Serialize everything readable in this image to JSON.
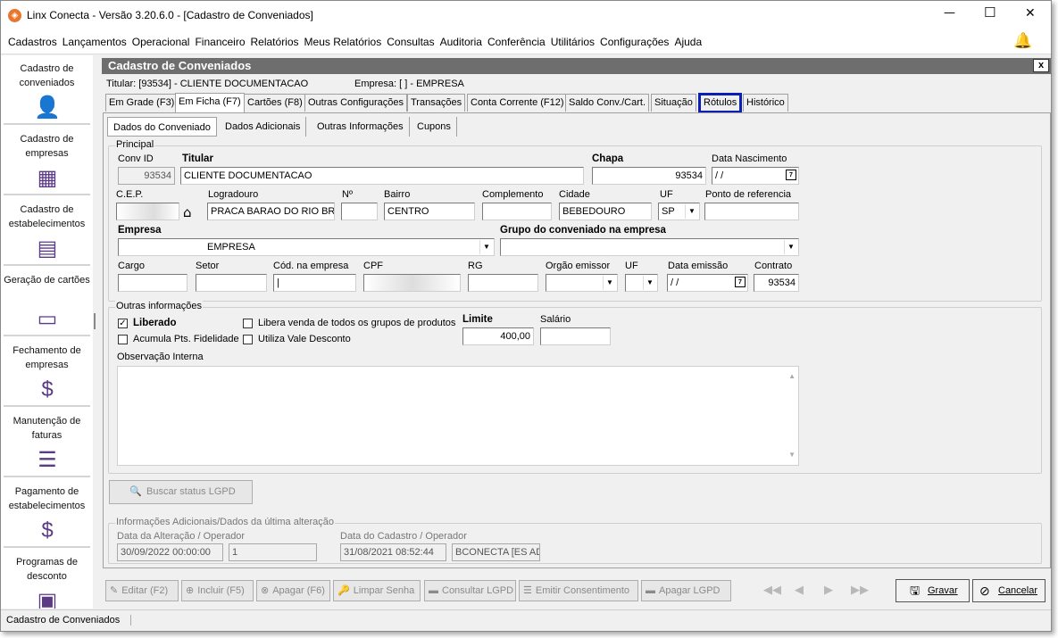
{
  "window": {
    "title": "Linx Conecta - Versão 3.20.6.0 - [Cadastro de Conveniados]",
    "minimize": "—",
    "maximize": "☐",
    "close": "✕"
  },
  "menu": [
    "Cadastros",
    "Lançamentos",
    "Operacional",
    "Financeiro",
    "Relatórios",
    "Meus Relatórios",
    "Consultas",
    "Auditoria",
    "Conferência",
    "Utilitários",
    "Configurações",
    "Ajuda"
  ],
  "sidebar": [
    {
      "label": "Cadastro de conveniados",
      "icon": "user-icon"
    },
    {
      "label": "Cadastro de empresas",
      "icon": "building-icon"
    },
    {
      "label": "Cadastro de estabelecimentos",
      "icon": "store-icon"
    },
    {
      "label": "Geração de cartões",
      "icon": "card-icon"
    },
    {
      "label": "Fechamento de empresas",
      "icon": "invoice-icon"
    },
    {
      "label": "Manutenção de faturas",
      "icon": "inbox-icon"
    },
    {
      "label": "Pagamento de estabelecimentos",
      "icon": "payment-icon"
    },
    {
      "label": "Programas de desconto",
      "icon": "discount-icon"
    }
  ],
  "panel": {
    "title": "Cadastro de Conveniados",
    "close": "x",
    "titular_line": "Titular: [93534] - CLIENTE DOCUMENTACAO",
    "empresa_line": "Empresa: [      ] - EMPRESA"
  },
  "tabs": [
    "Em Grade (F3)",
    "Em Ficha (F7)",
    "Cartões (F8)",
    "Outras Configurações",
    "Transações",
    "Conta Corrente (F12)",
    "Saldo Conv./Cart.",
    "Situação",
    "Rótulos",
    "Histórico"
  ],
  "subtabs": [
    "Dados do Conveniado",
    "Dados Adicionais",
    "Outras Informações",
    "Cupons"
  ],
  "principal": {
    "legend": "Principal",
    "conv_id_label": "Conv ID",
    "conv_id": "93534",
    "titular_label": "Titular",
    "titular": "CLIENTE DOCUMENTACAO",
    "chapa_label": "Chapa",
    "chapa": "93534",
    "nasc_label": "Data Nascimento",
    "nasc": "/ /",
    "cep_label": "C.E.P.",
    "logradouro_label": "Logradouro",
    "logradouro": "PRACA BARAO DO RIO BRA",
    "numero_label": "Nº",
    "bairro_label": "Bairro",
    "bairro": "CENTRO",
    "complemento_label": "Complemento",
    "cidade_label": "Cidade",
    "cidade": "BEBEDOURO",
    "uf_label": "UF",
    "uf": "SP",
    "referencia_label": "Ponto de referencia",
    "empresa_label": "Empresa",
    "empresa": "EMPRESA",
    "grupo_label": "Grupo do conveniado na empresa",
    "cargo_label": "Cargo",
    "setor_label": "Setor",
    "cod_empresa_label": "Cód. na empresa",
    "cpf_label": "CPF",
    "rg_label": "RG",
    "orgao_label": "Orgão emissor",
    "uf2_label": "UF",
    "emissao_label": "Data emissão",
    "emissao": "/ /",
    "contrato_label": "Contrato",
    "contrato": "93534"
  },
  "outras": {
    "legend": "Outras informações",
    "liberado": "Liberado",
    "libera_venda": "Libera venda de todos os grupos de produtos",
    "acumula": "Acumula Pts. Fidelidade",
    "vale": "Utiliza Vale Desconto",
    "limite_label": "Limite",
    "limite": "400,00",
    "salario_label": "Salário",
    "obs_label": "Observação Interna"
  },
  "lgpd_button": "Buscar status LGPD",
  "info": {
    "legend": "Informações Adicionais/Dados da última alteração",
    "alteracao_label": "Data da Alteração / Operador",
    "alteracao": "30/09/2022 00:00:00",
    "alteracao_op": "1",
    "cadastro_label": "Data do Cadastro / Operador",
    "cadastro": "31/08/2021 08:52:44",
    "cadastro_op": "BCONECTA [ES AD"
  },
  "toolbar": [
    "Editar (F2)",
    "Incluir (F5)",
    "Apagar (F6)",
    "Limpar Senha",
    "Consultar LGPD",
    "Emitir Consentimento",
    "Apagar LGPD"
  ],
  "gravar": "Gravar",
  "cancelar": "Cancelar",
  "status": "Cadastro de Conveniados",
  "accent": "#0b1fb5"
}
